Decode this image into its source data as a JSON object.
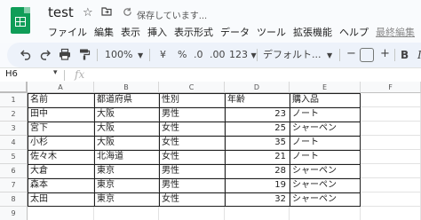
{
  "app": {
    "doc_title": "test",
    "save_status": "保存しています...",
    "last_edit": "最終編集"
  },
  "menu": [
    "ファイル",
    "編集",
    "表示",
    "挿入",
    "表示形式",
    "データ",
    "ツール",
    "拡張機能",
    "ヘルプ"
  ],
  "toolbar": {
    "zoom": "100%",
    "currency": "¥",
    "percent": "%",
    "decrease_decimal": ".0",
    "increase_decimal": ".00",
    "more_formats": "123",
    "font": "デフォルト...",
    "font_size_decrease": "−",
    "font_size_increase": "+",
    "bold": "B",
    "italic": "I"
  },
  "formula_bar": {
    "name_box": "H6",
    "fx": "fx"
  },
  "columns": [
    "A",
    "B",
    "C",
    "D",
    "E",
    "F"
  ],
  "rows": [
    "1",
    "2",
    "3",
    "4",
    "5",
    "6",
    "7",
    "8",
    "9"
  ],
  "table": {
    "header": [
      "名前",
      "都道府県",
      "性別",
      "年齢",
      "購入品"
    ],
    "data": [
      [
        "田中",
        "大阪",
        "男性",
        "23",
        "ノート"
      ],
      [
        "宮下",
        "大阪",
        "女性",
        "25",
        "シャーペン"
      ],
      [
        "小杉",
        "大阪",
        "女性",
        "35",
        "ノート"
      ],
      [
        "佐々木",
        "北海道",
        "女性",
        "21",
        "ノート"
      ],
      [
        "大倉",
        "東京",
        "男性",
        "28",
        "シャーペン"
      ],
      [
        "森本",
        "東京",
        "男性",
        "19",
        "シャーペン"
      ],
      [
        "太田",
        "東京",
        "女性",
        "32",
        "シャーペン"
      ]
    ]
  }
}
